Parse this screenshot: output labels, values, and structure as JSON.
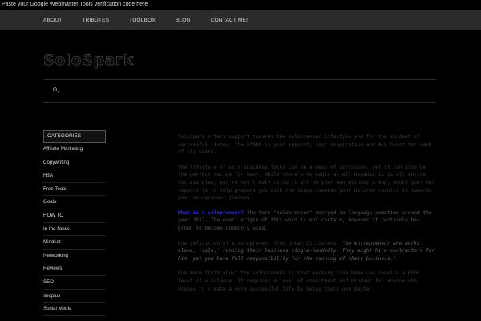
{
  "topbar": {
    "text": "Paste your Google Webmaster Tools verification code here"
  },
  "nav": {
    "items": [
      "ABOUT",
      "TRIBUTES",
      "TOOLBOX",
      "BLOG",
      "CONTACT ME!"
    ]
  },
  "site": {
    "title": "SoloSpark"
  },
  "sidebar": {
    "header": "CATEGORIES",
    "items": [
      "Affiliate Marketing",
      "Copywriting",
      "FBA",
      "Free Tools",
      "Goals",
      "HOW TO",
      "In the News",
      "Mindset",
      "Networking",
      "Reviews",
      "SEO",
      "seoplus",
      "Social Media"
    ]
  },
  "content": {
    "p1": "SoloSpark offers support towards the solopreneur lifestyle and for the mindset of successful living. The SPARK is your support, your inspiration and ALL heart for each of its users.",
    "p2": "The lifestyle of solo business folks can be a mess of confusion, yet it can also be the perfect recipe for many. While there's no magic at all because it is all entire success plan, you're not likely to do it all on your own without a map, would you? Our support is to help prepare you with the steps towards your desired results in towards your solopreneur journey.",
    "p3_link": "What is a solopreneur?",
    "p3_rest": " The term \"solopreneur\" emerged in language sometime around the year 2012. The exact origin of this word is not certain, however it certainly has grown to become commonly used.",
    "p4_lead": "One definition of a solopreneur from Urban Dictionary: ",
    "p4_quote": "\"An entrepreneur who works alone, 'solo,' running their business single-handedly. They might hire contractors for him, yet you have full responsibility for the running of their business.\"",
    "p5": "One more truth about the solopreneur is that working from home can require a HUGE level of a balance. It requires a level of commitment and mindset for anyone who wishes to create a more successful life by being their own master."
  }
}
